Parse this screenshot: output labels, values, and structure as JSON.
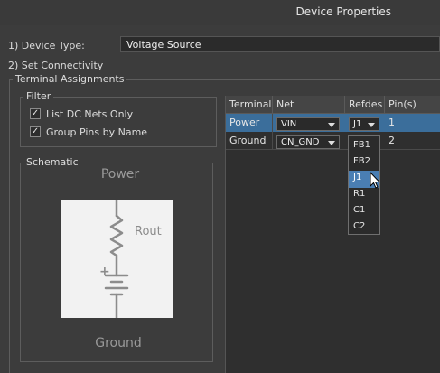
{
  "window": {
    "title": "Device Properties"
  },
  "device_type": {
    "label": "1) Device Type:",
    "value": "Voltage Source"
  },
  "connectivity": {
    "label": "2) Set Connectivity"
  },
  "terminal_assignments": {
    "title": "Terminal Assignments"
  },
  "filter": {
    "title": "Filter",
    "options": [
      {
        "label": "List DC Nets Only",
        "checked": true
      },
      {
        "label": "Group Pins by Name",
        "checked": true
      }
    ]
  },
  "schematic": {
    "title": "Schematic",
    "top_label": "Power",
    "bottom_label": "Ground",
    "resistor_label": "Rout",
    "plus_sign": "+"
  },
  "table": {
    "headers": [
      "Terminal",
      "Net",
      "Refdes",
      "Pin(s)"
    ],
    "rows": [
      {
        "terminal": "Power",
        "net": "VIN",
        "refdes": "J1",
        "pins": "1",
        "selected": true
      },
      {
        "terminal": "Ground",
        "net": "CN_GND",
        "refdes": "",
        "pins": "2",
        "selected": false
      }
    ]
  },
  "refdes_dropdown": {
    "options": [
      "FB1",
      "FB2",
      "J1",
      "R1",
      "C1",
      "C2"
    ],
    "highlighted": "J1"
  },
  "colors": {
    "selection": "#3b6e9b",
    "highlight": "#4a7eb3"
  }
}
